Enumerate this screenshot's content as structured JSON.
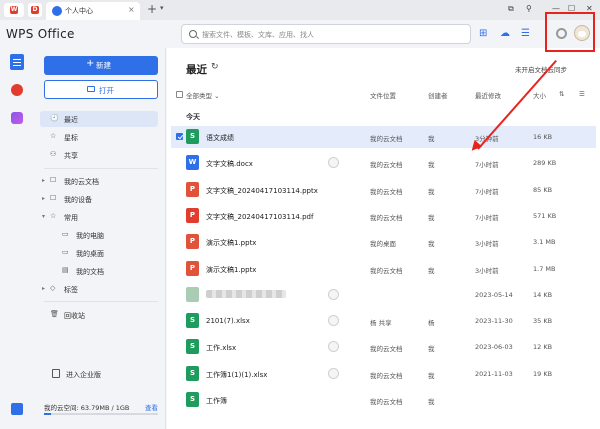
{
  "window": {
    "tab_label": "个人中心",
    "tab_close": "×",
    "tab_plus": "+",
    "tab_more": "▾",
    "logo_letter": "W",
    "logo2_letter": "D"
  },
  "header": {
    "app_title": "WPS Office",
    "search_placeholder": "搜索文件、模板、文库、应用、找人",
    "icons": [
      "apps-grid-icon",
      "cloud-sync-icon",
      "menu-icon",
      "settings-icon",
      "avatar"
    ]
  },
  "sidebar": {
    "new_label": "新建",
    "open_label": "打开",
    "nav": [
      {
        "label": "最近",
        "icon": "🕘",
        "active": true
      },
      {
        "label": "星标",
        "icon": "☆"
      },
      {
        "label": "共享",
        "icon": "⚇"
      }
    ],
    "groups": [
      {
        "label": "我的云文档",
        "icon": "☐",
        "arrow": "▸"
      },
      {
        "label": "我的设备",
        "icon": "☐",
        "arrow": "▸"
      },
      {
        "label": "常用",
        "icon": "☆",
        "arrow": "▾"
      }
    ],
    "sub_items": [
      {
        "label": "我的电脑",
        "icon": "▭"
      },
      {
        "label": "我的桌面",
        "icon": "▭"
      },
      {
        "label": "我的文档",
        "icon": "▤"
      }
    ],
    "tags": {
      "label": "标签",
      "icon": "◇",
      "arrow": "▸"
    },
    "trash": {
      "label": "回收站",
      "icon": "🗑"
    },
    "enterprise_label": "进入企业版",
    "space_label": "我的云空间: 63.79MB / 1GB",
    "space_link": "查看",
    "space_used_fraction": 0.0623
  },
  "main": {
    "title": "最近",
    "refresh_icon": "↻",
    "sync_label": "未开启文档云同步",
    "columns": {
      "type": "全部类型 ⌄",
      "location": "文件位置",
      "creator": "创建者",
      "modified": "最近修改",
      "size": "大小"
    },
    "group_today": "今天",
    "files": [
      {
        "name": "语文成绩",
        "type": "S",
        "color": "#1e9c5d",
        "location": "我的云文档",
        "creator": "我",
        "modified": "3分钟前",
        "size": "16 KB",
        "selected": true
      },
      {
        "name": "文字文稿.docx",
        "type": "W",
        "color": "#2f6fe8",
        "location": "我的云文档",
        "creator": "我",
        "modified": "7小时前",
        "size": "289 KB",
        "shared": true
      },
      {
        "name": "文字文稿_20240417103114.pptx",
        "type": "P",
        "color": "#e0533a",
        "location": "我的云文档",
        "creator": "我",
        "modified": "7小时前",
        "size": "85 KB"
      },
      {
        "name": "文字文稿_20240417103114.pdf",
        "type": "P",
        "color": "#e23c2e",
        "location": "我的云文档",
        "creator": "我",
        "modified": "7小时前",
        "size": "571 KB"
      },
      {
        "name": "演示文稿1.pptx",
        "type": "P",
        "color": "#e0533a",
        "location": "我的桌面",
        "creator": "我",
        "modified": "3小时前",
        "size": "3.1 MB"
      },
      {
        "name": "演示文稿1.pptx",
        "type": "P",
        "color": "#e0533a",
        "location": "我的云文档",
        "creator": "我",
        "modified": "3小时前",
        "size": "1.7 MB"
      },
      {
        "name": "",
        "type": "",
        "color": "#a9cdb4",
        "location": "",
        "creator": "",
        "modified": "2023-05-14",
        "size": "14 KB",
        "blurred": true,
        "shared": true
      },
      {
        "name": "2101(7).xlsx",
        "type": "S",
        "color": "#1e9c5d",
        "location": "杨 共享",
        "creator": "杨",
        "modified": "2023-11-30",
        "size": "35 KB",
        "shared": true
      },
      {
        "name": "工作.xlsx",
        "type": "S",
        "color": "#1e9c5d",
        "location": "我的云文档",
        "creator": "我",
        "modified": "2023-06-03",
        "size": "12 KB",
        "shared": true
      },
      {
        "name": "工作簿1(1)(1).xlsx",
        "type": "S",
        "color": "#1e9c5d",
        "location": "我的云文档",
        "creator": "我",
        "modified": "2021-11-03",
        "size": "19 KB",
        "shared": true
      },
      {
        "name": "工作簿",
        "type": "S",
        "color": "#1e9c5d",
        "location": "我的云文档",
        "creator": "我",
        "modified": "",
        "size": ""
      }
    ]
  },
  "colors": {
    "accent": "#2f6fe8",
    "annotation": "#e8221c"
  }
}
